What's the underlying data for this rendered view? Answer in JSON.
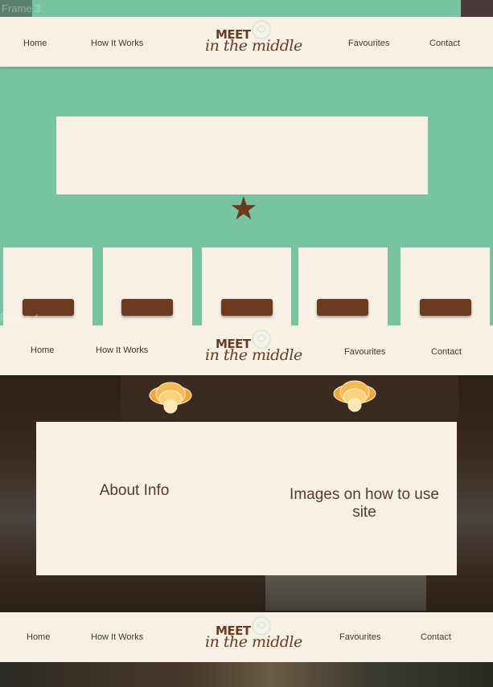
{
  "frames": {
    "frame3_label": "Frame 3",
    "frame4_label": "Frame 4"
  },
  "nav": {
    "home": "Home",
    "how_it_works": "How It Works",
    "favourites": "Favourites",
    "contact": "Contact"
  },
  "logo": {
    "line1": "MEET",
    "line2": "in the middle"
  },
  "hero": {
    "star": "★"
  },
  "about": {
    "left_text": "About Info",
    "right_text": "Images on how to use site"
  },
  "colors": {
    "background_green": "#78c3a1",
    "cream": "#f6f1e4",
    "brown": "#6b3a1f",
    "text_brown": "#4a3426"
  },
  "icons": {
    "logo_figure": "pin-heart-icon",
    "star": "star-icon",
    "lamp": "pendant-lamp-icon"
  }
}
